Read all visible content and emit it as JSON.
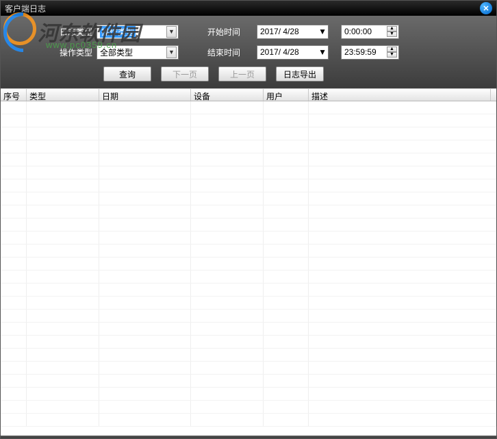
{
  "window": {
    "title": "客户端日志"
  },
  "filters": {
    "logTypeLabel": "日志类型",
    "logTypeValue": "操作类型",
    "opTypeLabel": "操作类型",
    "opTypeValue": "全部类型",
    "startLabel": "开始时间",
    "endLabel": "结束时间",
    "startDate": "2017/ 4/28",
    "endDate": "2017/ 4/28",
    "startTime": "0:00:00",
    "endTime": "23:59:59"
  },
  "buttons": {
    "query": "查询",
    "nextPage": "下一页",
    "prevPage": "上一页",
    "export": "日志导出"
  },
  "columns": {
    "c0": "序号",
    "c1": "类型",
    "c2": "日期",
    "c3": "设备",
    "c4": "用户",
    "c5": "描述"
  },
  "watermark": {
    "brand": "河东软件园",
    "url": "www.pc0359.cn"
  }
}
